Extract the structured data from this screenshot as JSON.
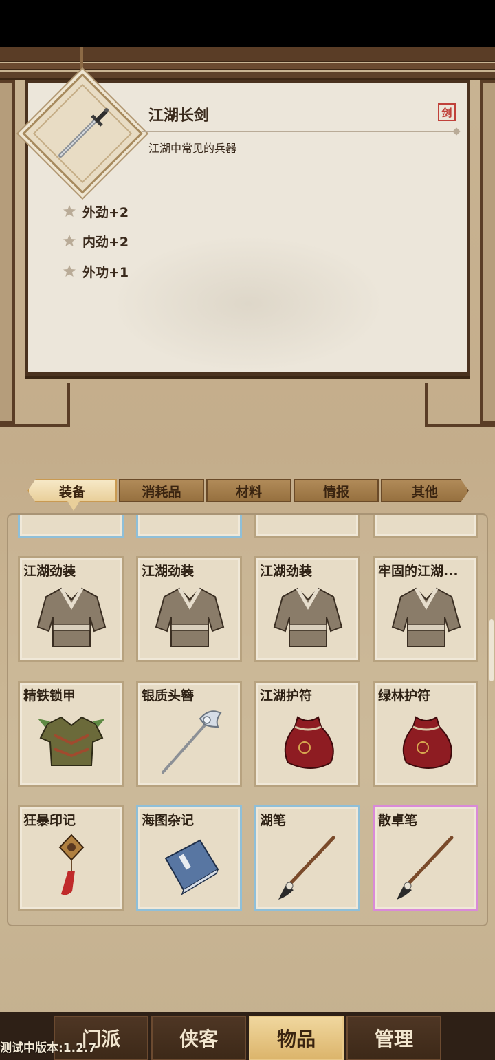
{
  "item_detail": {
    "name": "江湖长剑",
    "description": "江湖中常见的兵器",
    "seal": "剑",
    "stats": [
      "外劲+2",
      "内劲+2",
      "外功+1"
    ]
  },
  "tabs": [
    "装备",
    "消耗品",
    "材料",
    "情报",
    "其他"
  ],
  "active_tab": "装备",
  "inventory": [
    {
      "name": "江湖劲装",
      "icon": "robe-icon",
      "rarity": "common"
    },
    {
      "name": "江湖劲装",
      "icon": "robe-icon",
      "rarity": "common"
    },
    {
      "name": "江湖劲装",
      "icon": "robe-icon",
      "rarity": "common"
    },
    {
      "name": "牢固的江湖...",
      "icon": "robe-icon",
      "rarity": "common"
    },
    {
      "name": "精铁锁甲",
      "icon": "armor-icon",
      "rarity": "common"
    },
    {
      "name": "银质头簪",
      "icon": "hairpin-icon",
      "rarity": "common"
    },
    {
      "name": "江湖护符",
      "icon": "pouch-icon",
      "rarity": "common"
    },
    {
      "name": "绿林护符",
      "icon": "pouch-icon",
      "rarity": "common"
    },
    {
      "name": "狂暴印记",
      "icon": "pendant-icon",
      "rarity": "common"
    },
    {
      "name": "海图杂记",
      "icon": "book-icon",
      "rarity": "blue"
    },
    {
      "name": "湖笔",
      "icon": "brush-icon",
      "rarity": "blue"
    },
    {
      "name": "散卓笔",
      "icon": "brush-icon",
      "rarity": "pink"
    }
  ],
  "bottom_nav": [
    "门派",
    "侠客",
    "物品",
    "管理"
  ],
  "active_nav": "物品",
  "version": "测试中版本:1.2.7",
  "colors": {
    "blue_rarity": "#8fbfd8",
    "pink_rarity": "#d98ad8",
    "accent": "#e9cf9a"
  }
}
